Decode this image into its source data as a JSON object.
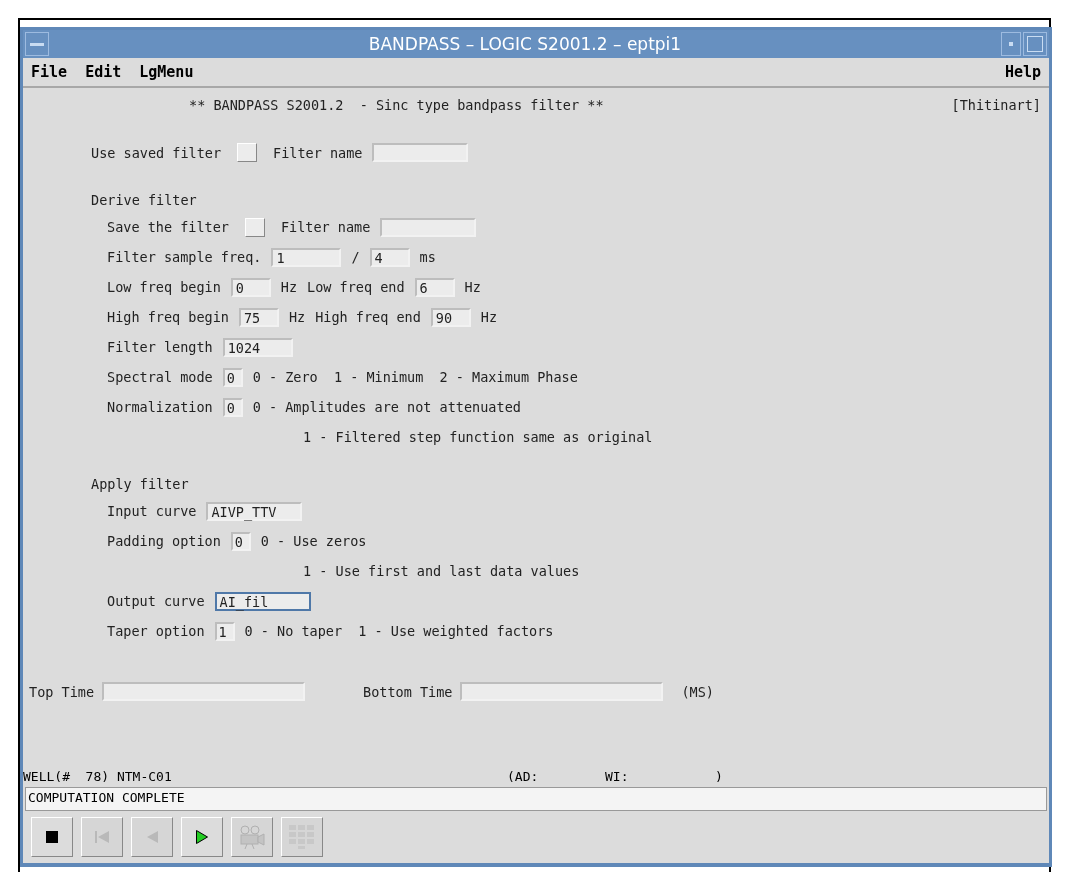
{
  "window": {
    "title": "BANDPASS – LOGIC S2001.2 – eptpi1"
  },
  "menu": [
    {
      "label": "File"
    },
    {
      "label": "Edit"
    },
    {
      "label": "LgMenu"
    }
  ],
  "help_menu": {
    "label": "Help"
  },
  "header": {
    "title": "** BANDPASS S2001.2  - Sinc type bandpass filter **",
    "user": "[Thitinart]"
  },
  "sections": [
    {
      "rows": [
        {
          "kind": "row",
          "items": [
            {
              "kind": "label",
              "text": "Use saved filter"
            },
            {
              "kind": "checkbox",
              "checked": false
            },
            {
              "kind": "label",
              "text": "Filter name"
            },
            {
              "kind": "field",
              "focused": false
            }
          ]
        }
      ]
    },
    {
      "title": "Derive filter",
      "rows": [
        {
          "kind": "row",
          "items": [
            {
              "kind": "label",
              "text": "Save the filter"
            },
            {
              "kind": "checkbox",
              "checked": false
            },
            {
              "kind": "label",
              "text": "Filter name"
            },
            {
              "kind": "field",
              "focused": false
            }
          ]
        },
        {
          "kind": "row",
          "items": [
            {
              "kind": "label",
              "text": "Filter sample freq."
            },
            {
              "kind": "mid-field",
              "value": "1",
              "focused": false
            },
            {
              "kind": "label",
              "text": "/"
            },
            {
              "kind": "short-field",
              "value": "4",
              "focused": false
            },
            {
              "kind": "label",
              "text": "ms"
            }
          ]
        },
        {
          "kind": "row",
          "items": [
            {
              "kind": "label",
              "text": "Low freq begin"
            },
            {
              "kind": "short-field",
              "value": "0",
              "focused": false
            },
            {
              "kind": "label",
              "text": "Hz"
            },
            {
              "kind": "label",
              "text": "Low freq end"
            },
            {
              "kind": "short-field",
              "value": "6",
              "focused": false
            },
            {
              "kind": "label",
              "text": "Hz"
            }
          ]
        },
        {
          "kind": "row",
          "items": [
            {
              "kind": "label",
              "text": "High freq begin"
            },
            {
              "kind": "short-field",
              "value": "75",
              "focused": false
            },
            {
              "kind": "label",
              "text": "Hz"
            },
            {
              "kind": "label",
              "text": "High freq end"
            },
            {
              "kind": "short-field",
              "value": "90",
              "focused": false
            },
            {
              "kind": "label",
              "text": "Hz"
            }
          ]
        },
        {
          "kind": "row",
          "items": [
            {
              "kind": "label",
              "text": "Filter length"
            },
            {
              "kind": "mid-field",
              "value": "1024",
              "focused": false
            }
          ]
        },
        {
          "kind": "row",
          "items": [
            {
              "kind": "label",
              "text": "Spectral mode"
            },
            {
              "kind": "digit-field",
              "value": "0",
              "focused": false
            },
            {
              "kind": "label",
              "text": "0 - Zero  1 - Minimum  2 - Maximum Phase"
            }
          ]
        },
        {
          "kind": "row",
          "items": [
            {
              "kind": "label",
              "text": "Normalization"
            },
            {
              "kind": "digit-field",
              "value": "0",
              "focused": false
            },
            {
              "kind": "label",
              "text": "0 - Amplitudes are not attenuated"
            }
          ]
        },
        {
          "kind": "continuation",
          "items": [
            {
              "kind": "label",
              "text": "1 - Filtered step function same as original"
            }
          ]
        }
      ]
    },
    {
      "title": "Apply filter",
      "rows": [
        {
          "kind": "row",
          "items": [
            {
              "kind": "label",
              "text": "Input curve"
            },
            {
              "kind": "field",
              "value": "AIVP_TTV",
              "focused": false
            }
          ]
        },
        {
          "kind": "row",
          "items": [
            {
              "kind": "label",
              "text": "Padding option"
            },
            {
              "kind": "digit-field",
              "value": "0",
              "focused": false
            },
            {
              "kind": "label",
              "text": "0 - Use zeros"
            }
          ]
        },
        {
          "kind": "continuation",
          "items": [
            {
              "kind": "label",
              "text": "1 - Use first and last data values"
            }
          ]
        },
        {
          "kind": "row",
          "items": [
            {
              "kind": "label",
              "text": "Output curve"
            },
            {
              "kind": "field",
              "value": "AI_fil",
              "focused": true
            }
          ]
        },
        {
          "kind": "row",
          "items": [
            {
              "kind": "label",
              "text": "Taper option"
            },
            {
              "kind": "digit-field",
              "value": "1",
              "focused": false
            },
            {
              "kind": "label",
              "text": "0 - No taper  1 - Use weighted factors"
            }
          ]
        }
      ]
    }
  ],
  "time_range": {
    "top_label": "Top Time",
    "bottom_label": "Bottom Time",
    "unit": "(MS)"
  },
  "well_line": [
    "WELL(#  78) NTM-C01",
    "(AD:",
    "WI:",
    ")"
  ],
  "message": "COMPUTATION COMPLETE",
  "toolbar": [
    {
      "kind": "stop",
      "disabled": false
    },
    {
      "kind": "first",
      "disabled": true
    },
    {
      "kind": "back",
      "disabled": true
    },
    {
      "kind": "play",
      "disabled": false
    },
    {
      "kind": "camera",
      "disabled": true
    },
    {
      "kind": "grid",
      "disabled": true
    }
  ]
}
